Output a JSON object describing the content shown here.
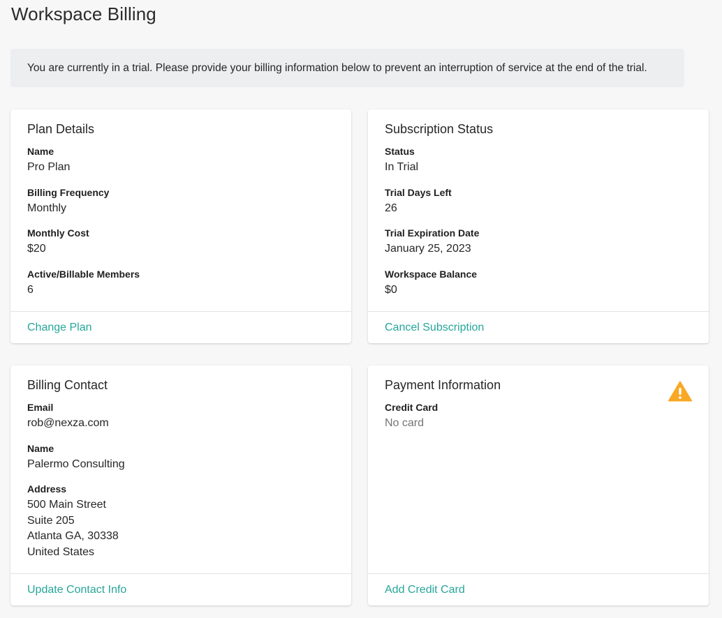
{
  "page": {
    "title": "Workspace Billing"
  },
  "notice": {
    "text": "You are currently in a trial. Please provide your billing information below to prevent an interruption of service at the end of the trial."
  },
  "plan_details": {
    "title": "Plan Details",
    "fields": [
      {
        "label": "Name",
        "value": "Pro Plan"
      },
      {
        "label": "Billing Frequency",
        "value": "Monthly"
      },
      {
        "label": "Monthly Cost",
        "value": "$20"
      },
      {
        "label": "Active/Billable Members",
        "value": "6"
      }
    ],
    "action": "Change Plan"
  },
  "subscription_status": {
    "title": "Subscription Status",
    "fields": [
      {
        "label": "Status",
        "value": "In Trial"
      },
      {
        "label": "Trial Days Left",
        "value": "26"
      },
      {
        "label": "Trial Expiration Date",
        "value": "January 25, 2023"
      },
      {
        "label": "Workspace Balance",
        "value": "$0"
      }
    ],
    "action": "Cancel Subscription"
  },
  "billing_contact": {
    "title": "Billing Contact",
    "email_label": "Email",
    "email": "rob@nexza.com",
    "name_label": "Name",
    "name": "Palermo Consulting",
    "address_label": "Address",
    "address_lines": [
      "500 Main Street",
      "Suite 205",
      "Atlanta GA, 30338",
      "United States"
    ],
    "action": "Update Contact Info"
  },
  "payment_information": {
    "title": "Payment Information",
    "credit_card_label": "Credit Card",
    "credit_card_value": "No card",
    "warning_icon": "warning-triangle-icon",
    "action": "Add Credit Card"
  },
  "colors": {
    "accent": "#26a69a",
    "warning": "#f9a825",
    "notice_bg": "#eceef0",
    "page_bg": "#f7f7f7"
  }
}
